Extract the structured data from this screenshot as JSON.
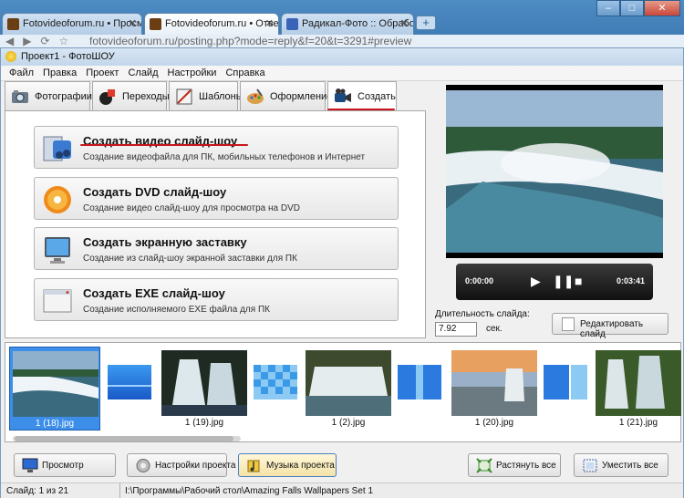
{
  "browser": {
    "tabs": [
      {
        "label": "Fotovideoforum.ru • Просм",
        "active": false
      },
      {
        "label": "Fotovideoforum.ru • Ответ",
        "active": true
      },
      {
        "label": "Радикал-Фото :: Обработк",
        "active": false
      }
    ],
    "new_tab": "+",
    "url": "fotovideoforum.ru/posting.php?mode=reply&f=20&t=3291#preview"
  },
  "app": {
    "title": "Проект1 - ФотоШОУ",
    "menu": [
      "Файл",
      "Правка",
      "Проект",
      "Слайд",
      "Настройки",
      "Справка"
    ],
    "tabs": [
      {
        "label": "Фотографии",
        "icon": "photos-icon"
      },
      {
        "label": "Переходы",
        "icon": "transitions-icon"
      },
      {
        "label": "Шаблоны",
        "icon": "templates-icon"
      },
      {
        "label": "Оформление",
        "icon": "design-icon"
      },
      {
        "label": "Создать",
        "icon": "create-film-icon",
        "active": true
      }
    ],
    "create_options": [
      {
        "title": "Создать видео слайд-шоу",
        "desc": "Создание видеофайла для ПК, мобильных телефонов и Интернет"
      },
      {
        "title": "Создать DVD слайд-шоу",
        "desc": "Создание видео слайд-шоу для просмотра на DVD"
      },
      {
        "title": "Создать экранную заставку",
        "desc": "Создание из слайд-шоу экранной заставки для ПК"
      },
      {
        "title": "Создать EXE слайд-шоу",
        "desc": "Создание исполняемого EXE файла для ПК"
      }
    ],
    "player": {
      "time_current": "0:00:00",
      "time_total": "0:03:41"
    },
    "slide_duration": {
      "label": "Длительность слайда:",
      "value": "7.92",
      "unit": "сек."
    },
    "edit_slide_button": "Редактировать слайд",
    "slides": [
      {
        "caption": "1 (18).jpg",
        "selected": true
      },
      {
        "caption": "1 (19).jpg"
      },
      {
        "caption": "1 (2).jpg"
      },
      {
        "caption": "1 (20).jpg"
      },
      {
        "caption": "1 (21).jpg"
      }
    ],
    "bottom_buttons": {
      "preview": "Просмотр",
      "project_settings": "Настройки проекта",
      "project_music": "Музыка проекта",
      "stretch_all": "Растянуть все",
      "fit_all": "Уместить все"
    },
    "status": {
      "slide_info": "Слайд: 1 из 21",
      "path": "I:\\Программы\\Рабочий стол\\Amazing Falls Wallpapers Set 1"
    }
  }
}
